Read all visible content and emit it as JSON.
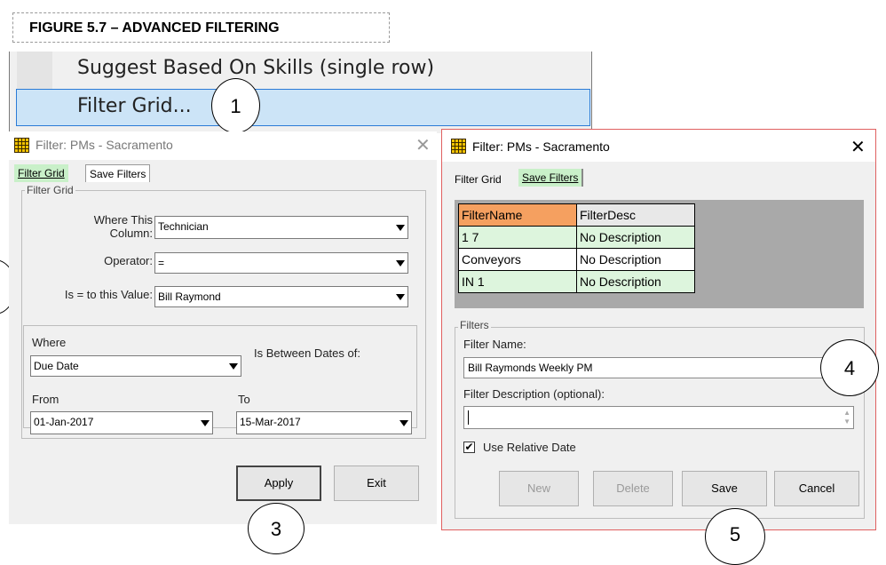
{
  "figure_caption": "FIGURE 5.7 – ADVANCED FILTERING",
  "context_menu": {
    "items": [
      "Suggest Based On Skills (single row)",
      "Filter Grid..."
    ]
  },
  "callouts": [
    "1",
    "3",
    "4",
    "5"
  ],
  "left_dialog": {
    "title": "Filter: PMs - Sacramento",
    "tabs": [
      "Filter Grid",
      "Save Filters"
    ],
    "group_title": "Filter Grid",
    "where_column_label": "Where This\nColumn:",
    "where_column_value": "Technician",
    "operator_label": "Operator:",
    "operator_value": "=",
    "value_label": "Is = to this Value:",
    "value_value": "Bill Raymond",
    "where_label": "Where",
    "where_date_value": "Due Date",
    "between_label": "Is Between Dates of:",
    "from_label": "From",
    "from_value": "01-Jan-2017",
    "to_label": "To",
    "to_value": "15-Mar-2017",
    "apply_label": "Apply",
    "exit_label": "Exit"
  },
  "right_dialog": {
    "title": "Filter: PMs - Sacramento",
    "tabs": [
      "Filter Grid",
      "Save Filters"
    ],
    "table": {
      "columns": [
        "FilterName",
        "FilterDesc"
      ],
      "rows": [
        [
          "1 7",
          "No Description"
        ],
        [
          "Conveyors",
          "No Description"
        ],
        [
          "IN 1",
          "No Description"
        ]
      ]
    },
    "filters_group_title": "Filters",
    "filter_name_label": "Filter Name:",
    "filter_name_value": "Bill Raymonds Weekly PM",
    "filter_desc_label": "Filter Description (optional):",
    "filter_desc_value": "",
    "relative_date_label": "Use Relative Date",
    "relative_date_checked": true,
    "buttons": {
      "new": "New",
      "delete": "Delete",
      "save": "Save",
      "cancel": "Cancel"
    }
  },
  "colors": {
    "menu_highlight": "#cce4f7",
    "active_tab": "#c9f0c9",
    "header_orange": "#f5a060",
    "row_green": "#ddf5dd",
    "grid_bg": "#a9a9a9",
    "dialog_border_right": "#e06060"
  }
}
